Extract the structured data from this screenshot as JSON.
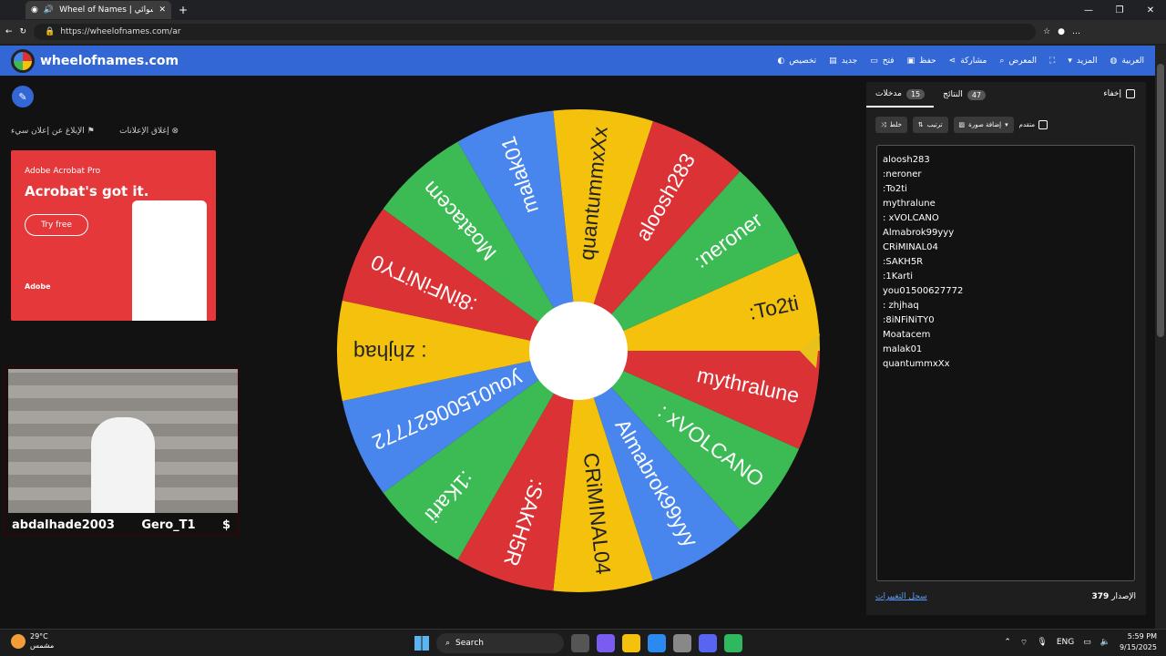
{
  "browser": {
    "tab_title": "Wheel of Names | العشوائي ...",
    "url": "https://wheelofnames.com/ar"
  },
  "app": {
    "brand": "wheelofnames.com",
    "menu": [
      {
        "label": "تخصيص",
        "icon": "palette-icon"
      },
      {
        "label": "جديد",
        "icon": "file-icon"
      },
      {
        "label": "فتح",
        "icon": "folder-icon"
      },
      {
        "label": "حفظ",
        "icon": "save-icon"
      },
      {
        "label": "مشاركة",
        "icon": "share-icon"
      },
      {
        "label": "المعرض",
        "icon": "search-icon"
      },
      {
        "label": "",
        "icon": "fullscreen-icon"
      },
      {
        "label": "المزيد",
        "icon": "caret-down-icon"
      },
      {
        "label": "العربية",
        "icon": "globe-icon"
      }
    ]
  },
  "ads": {
    "report_label": "الإبلاغ عن إعلان سيء",
    "close_label": "إغلاق الإعلانات",
    "ad_product": "Adobe Acrobat Pro",
    "ad_headline": "Acrobat's got it.",
    "ad_button": "Try free",
    "ad_brand": "Adobe"
  },
  "webcam": {
    "name_left": "abdalhade2003",
    "name_right": "Gero_T1",
    "symbol": "$"
  },
  "panel": {
    "tab_entries": "مدخلات",
    "entries_count": "15",
    "tab_results": "النتائج",
    "results_count": "47",
    "hide_label": "إخفاء",
    "shuffle": "خلط",
    "sort": "ترتيب",
    "add_image": "إضافة صورة",
    "advanced": "متقدم",
    "version_label": "الإصدار",
    "version_value": "379",
    "changelog": "سجل التغييرات"
  },
  "entries": [
    "aloosh283",
    ":neroner",
    ":To2ti",
    "mythralune",
    ": xVOLCANO",
    "Almabrok99yyy",
    "CRiMINAL04",
    ":SAKH5R",
    ":1Karti",
    "you01500627772",
    ": zhjhaq",
    ":8iNFiNiTY0",
    "Moatacem",
    "malak01",
    "quantummxXx"
  ],
  "wheel": {
    "colors": [
      "#f4c20d",
      "#db3236",
      "#3cba54",
      "#4885ed"
    ],
    "slices": [
      ":To2ti",
      "mythralune",
      ": xVOLCANO",
      "Almabrok99yyy",
      "CRiMINAL04",
      ":SAKH5R",
      ":1Karti",
      "you01500627772",
      ": zhjhaq",
      ":8iNFiNiTY0",
      "Moatacem",
      "malak01",
      "quantummxXx",
      "aloosh283",
      ":neroner"
    ]
  },
  "taskbar": {
    "temp": "29°C",
    "weather": "مشمس",
    "search": "Search",
    "lang": "ENG",
    "time": "5:59 PM",
    "date": "9/15/2025"
  }
}
